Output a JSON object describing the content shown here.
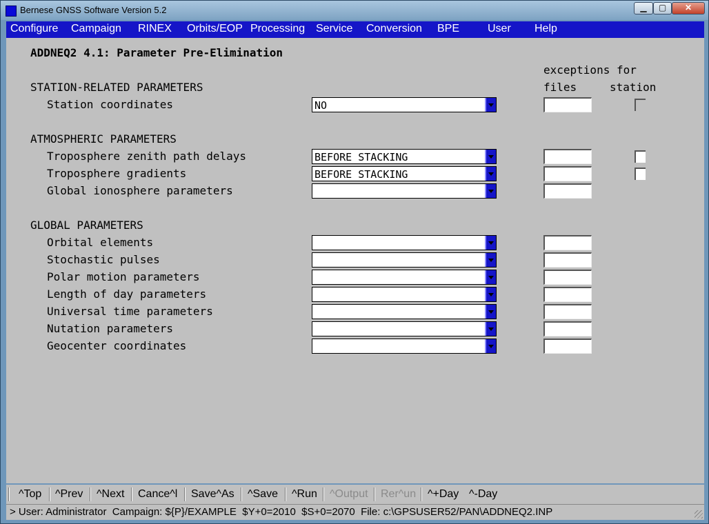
{
  "window": {
    "title": "Bernese GNSS Software Version 5.2"
  },
  "menu": [
    "Configure",
    "Campaign",
    "RINEX",
    "Orbits/EOP",
    "Processing",
    "Service",
    "Conversion",
    "BPE",
    "User",
    "Help"
  ],
  "panel": {
    "title": "ADDNEQ2 4.1: Parameter Pre-Elimination",
    "exceptions_header": "exceptions for",
    "files_header": "files",
    "station_header": "station",
    "sections": [
      {
        "title": "STATION-RELATED PARAMETERS"
      },
      {
        "title": "ATMOSPHERIC PARAMETERS"
      },
      {
        "title": "GLOBAL PARAMETERS"
      }
    ],
    "rows": [
      {
        "label": "Station coordinates",
        "value": "NO",
        "files": "",
        "station_check": "unavailable"
      },
      {
        "label": "Troposphere zenith path delays",
        "value": "BEFORE STACKING",
        "files": "",
        "station_check": false
      },
      {
        "label": "Troposphere gradients",
        "value": "BEFORE STACKING",
        "files": "",
        "station_check": false
      },
      {
        "label": "Global ionosphere parameters",
        "value": "",
        "files": ""
      },
      {
        "label": "Orbital elements",
        "value": "",
        "files": ""
      },
      {
        "label": "Stochastic pulses",
        "value": "",
        "files": ""
      },
      {
        "label": "Polar motion parameters",
        "value": "",
        "files": ""
      },
      {
        "label": "Length of day parameters",
        "value": "",
        "files": ""
      },
      {
        "label": "Universal time parameters",
        "value": "",
        "files": ""
      },
      {
        "label": "Nutation parameters",
        "value": "",
        "files": ""
      },
      {
        "label": "Geocenter coordinates",
        "value": "",
        "files": ""
      }
    ]
  },
  "buttons": [
    {
      "label": "^Top",
      "enabled": true
    },
    {
      "label": "^Prev",
      "enabled": true
    },
    {
      "label": "^Next",
      "enabled": true
    },
    {
      "label": "Cance^l",
      "enabled": true
    },
    {
      "label": "Save^As",
      "enabled": true
    },
    {
      "label": "^Save",
      "enabled": true
    },
    {
      "label": "^Run",
      "enabled": true
    },
    {
      "label": "^Output",
      "enabled": false
    },
    {
      "label": "Rer^un",
      "enabled": false
    },
    {
      "label": "^+Day",
      "enabled": true
    },
    {
      "label": "^-Day",
      "enabled": true
    }
  ],
  "status": "> User: Administrator  Campaign: ${P}/EXAMPLE  $Y+0=2010  $S+0=2070  File: c:\\GPSUSER52/PAN\\ADDNEQ2.INP",
  "colors": {
    "menubar": "#1515c8",
    "dropdown_arrow": "#1515c8",
    "client_background": "#c0c0c0"
  }
}
